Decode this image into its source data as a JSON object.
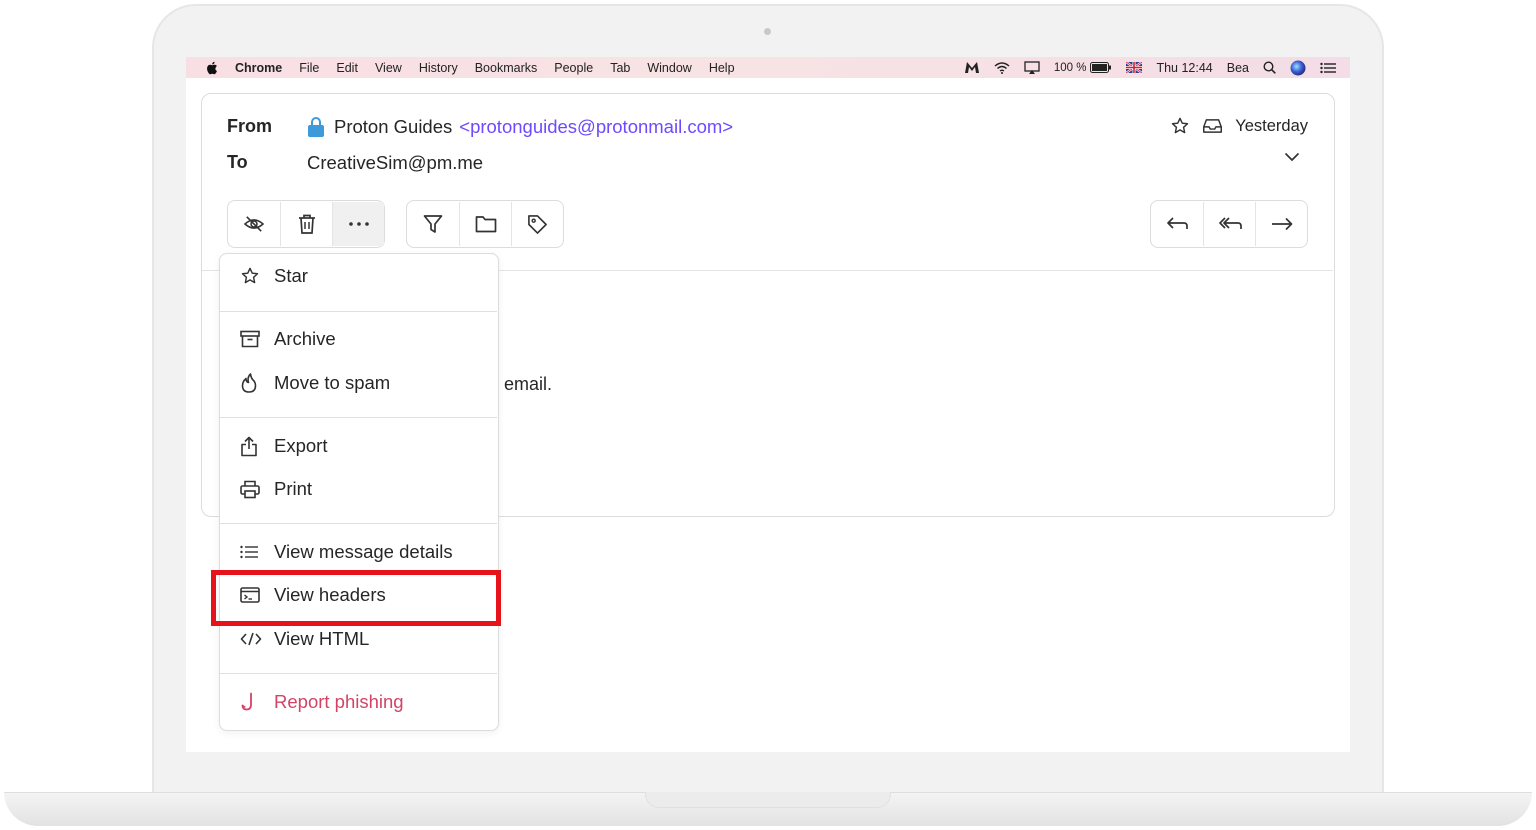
{
  "menubar": {
    "app": "Chrome",
    "items": [
      "File",
      "Edit",
      "View",
      "History",
      "Bookmarks",
      "People",
      "Tab",
      "Window",
      "Help"
    ],
    "battery": "100 %",
    "clock": "Thu 12:44",
    "user": "Bea"
  },
  "email": {
    "from_label": "From",
    "to_label": "To",
    "sender_name": "Proton Guides",
    "sender_email": "<protonguides@protonmail.com>",
    "recipient": "CreativeSim@pm.me",
    "date": "Yesterday",
    "body_fragment": "email."
  },
  "menu": {
    "star": "Star",
    "archive": "Archive",
    "spam": "Move to spam",
    "export": "Export",
    "print": "Print",
    "details": "View message details",
    "headers": "View headers",
    "html": "View HTML",
    "phishing": "Report phishing"
  },
  "colors": {
    "accent": "#6d4aff",
    "lock": "#3e9ad8",
    "danger": "#d24466",
    "highlight": "#e8131a"
  }
}
